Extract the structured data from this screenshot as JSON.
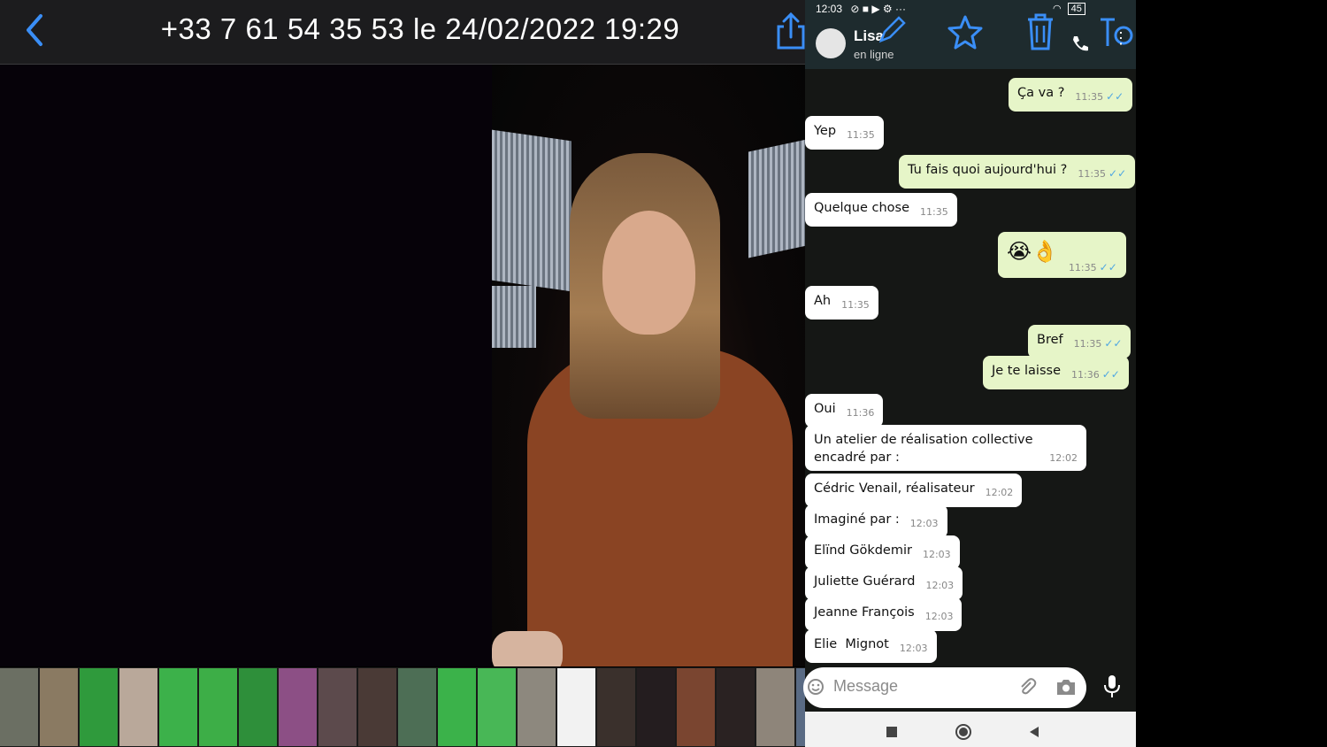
{
  "viewer": {
    "title": "+33 7 61 54 35 53 le 24/02/2022 19:29"
  },
  "status_bar": {
    "time": "12:03",
    "icons": "⊘ ■ ▶ ⚙ ···",
    "right": "45"
  },
  "chat": {
    "contact_name": "Lisa",
    "contact_status": "en ligne",
    "messages": [
      {
        "dir": "out",
        "text": "Ça va ?",
        "time": "11:35"
      },
      {
        "dir": "in",
        "text": "Yep",
        "time": "11:35"
      },
      {
        "dir": "out",
        "text": "Tu fais quoi aujourd'hui ?",
        "time": "11:35"
      },
      {
        "dir": "in",
        "text": "Quelque chose",
        "time": "11:35"
      },
      {
        "dir": "out",
        "text": "😭👌",
        "time": "11:35"
      },
      {
        "dir": "in",
        "text": "Ah",
        "time": "11:35"
      },
      {
        "dir": "out",
        "text": "Bref",
        "time": "11:35"
      },
      {
        "dir": "out",
        "text": "Je te laisse",
        "time": "11:36"
      },
      {
        "dir": "in",
        "text": "Oui",
        "time": "11:36"
      },
      {
        "dir": "in",
        "text": "Un atelier de réalisation collective encadré par :",
        "time": "12:02"
      },
      {
        "dir": "in",
        "text": "Cédric Venail, réalisateur",
        "time": "12:02"
      },
      {
        "dir": "in",
        "text": "Imaginé par :",
        "time": "12:03"
      },
      {
        "dir": "in",
        "text": "Elïnd Gökdemir",
        "time": "12:03"
      },
      {
        "dir": "in",
        "text": "Juliette Guérard",
        "time": "12:03"
      },
      {
        "dir": "in",
        "text": "Jeanne François",
        "time": "12:03"
      },
      {
        "dir": "in",
        "text": "Elie  Mignot",
        "time": "12:03"
      }
    ],
    "input_placeholder": "Message",
    "ticks": "✓✓"
  },
  "colors": {
    "accent_blue": "#3a8ef6",
    "bubble_out": "#e6f5c8",
    "bubble_in": "#ffffff"
  }
}
